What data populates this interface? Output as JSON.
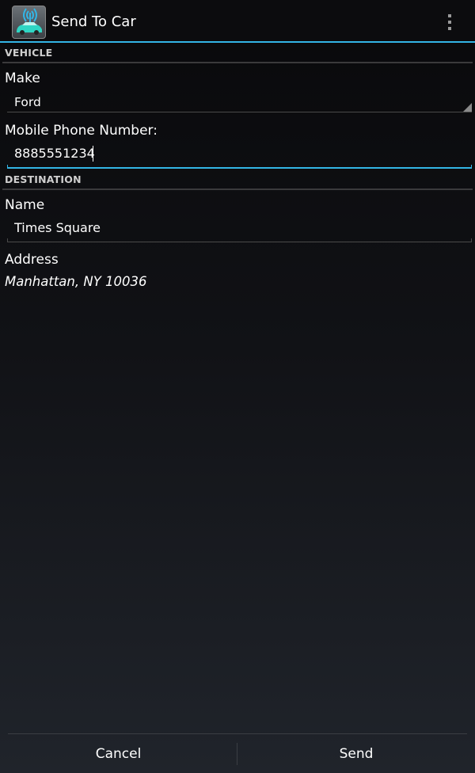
{
  "app": {
    "title": "Send To Car",
    "icon": "car-signal-icon"
  },
  "vehicle": {
    "header": "VEHICLE",
    "make_label": "Make",
    "make_value": "Ford",
    "phone_label": "Mobile Phone Number:",
    "phone_value": "8885551234"
  },
  "destination": {
    "header": "DESTINATION",
    "name_label": "Name",
    "name_value": "Times Square",
    "address_label": "Address",
    "address_value": "Manhattan, NY 10036"
  },
  "buttons": {
    "cancel": "Cancel",
    "send": "Send"
  },
  "colors": {
    "accent": "#33b5e5",
    "background": "#111216",
    "text": "#ffffff"
  }
}
